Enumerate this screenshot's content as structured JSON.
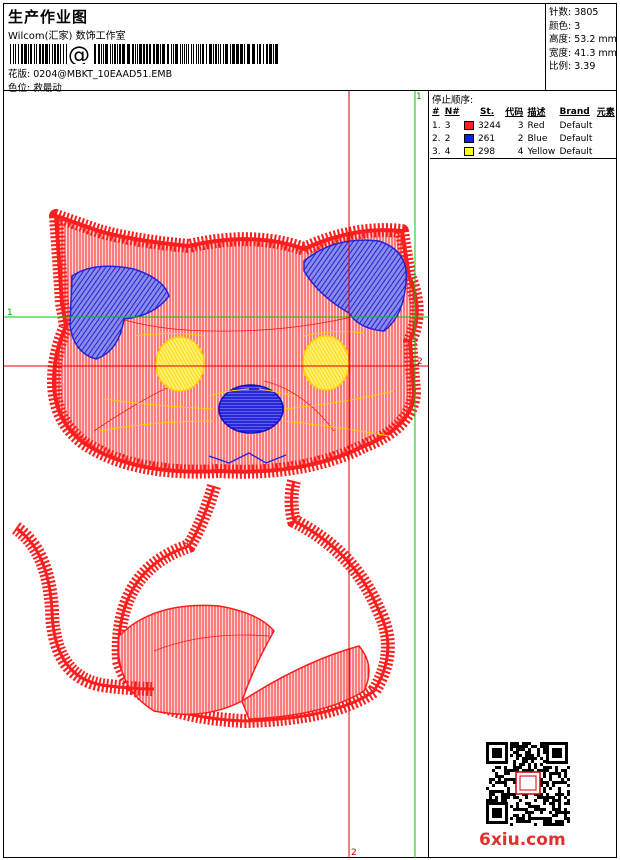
{
  "header": {
    "title": "生产作业图",
    "company": "Wilcom(汇家) 数饰工作室",
    "barcode_symbol": "@",
    "design_label": "花版:",
    "design_value": "0204@MBKT_10EAAD51.EMB",
    "color_label": "色位:",
    "color_value": "救最动"
  },
  "stats": [
    {
      "label": "针数:",
      "value": "3805"
    },
    {
      "label": "颜色:",
      "value": "3"
    },
    {
      "label": "高度:",
      "value": "53.2 mm"
    },
    {
      "label": "宽度:",
      "value": "41.3 mm"
    },
    {
      "label": "比例:",
      "value": "3.39"
    }
  ],
  "stop_sequence": {
    "title": "停止顺序:",
    "columns": [
      "#",
      "N#",
      "St.",
      "代码",
      "描述",
      "Brand",
      "元素"
    ],
    "rows": [
      {
        "idx": "1.",
        "n": "3",
        "color": "#ff2020",
        "st": "3244",
        "code": "3",
        "desc": "Red",
        "brand": "Default",
        "elem": ""
      },
      {
        "idx": "2.",
        "n": "2",
        "color": "#1020e0",
        "st": "261",
        "code": "2",
        "desc": "Blue",
        "brand": "Default",
        "elem": ""
      },
      {
        "idx": "3.",
        "n": "4",
        "color": "#ffff20",
        "st": "298",
        "code": "4",
        "desc": "Yellow",
        "brand": "Default",
        "elem": ""
      }
    ]
  },
  "guides": {
    "horizontal_1": "1",
    "horizontal_2": "2",
    "vertical_1": "1",
    "vertical_2": "2"
  },
  "colors": {
    "red": "#ff1e1e",
    "blue": "#2424d8",
    "yellow": "#ffe020",
    "guide_green": "#00c800",
    "guide_red": "#e00000"
  },
  "watermark": "6xiu.com"
}
